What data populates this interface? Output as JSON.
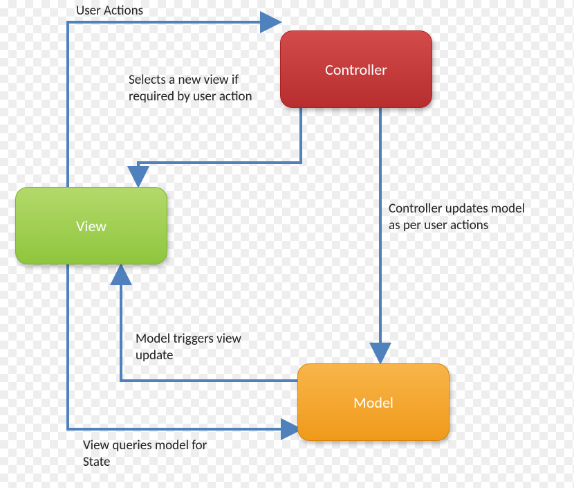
{
  "nodes": {
    "controller": "Controller",
    "view": "View",
    "model": "Model"
  },
  "edges": {
    "user_actions": "User Actions",
    "selects_view": "Selects a new view if required by user action",
    "controller_updates": "Controller updates model as per user actions",
    "model_triggers": "Model  triggers view update",
    "view_queries": "View queries model for State"
  },
  "colors": {
    "controller": "#b82e2e",
    "view": "#8fc63d",
    "model": "#f09a1a",
    "arrow": "#4f81bd"
  }
}
